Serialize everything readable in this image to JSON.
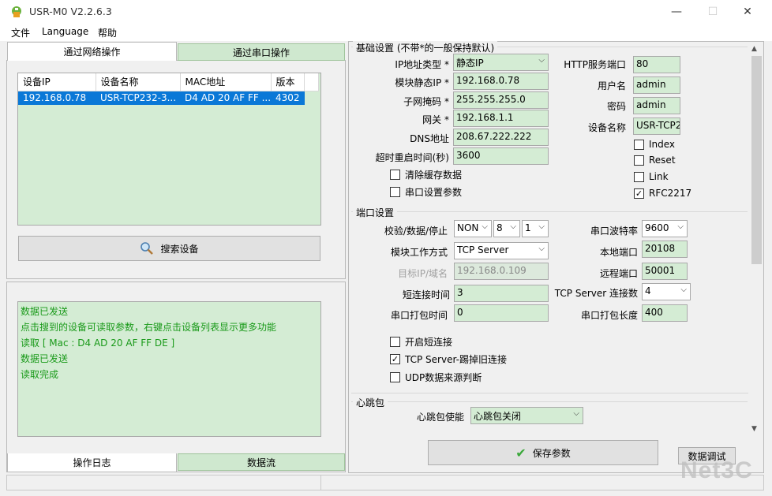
{
  "window": {
    "title": "USR-M0 V2.2.6.3"
  },
  "controls": {
    "minimize": "—",
    "maximize": "☐",
    "close": "✕"
  },
  "menu": [
    "文件",
    "Language",
    "帮助"
  ],
  "left": {
    "tabs": [
      "通过网络操作",
      "通过串口操作"
    ],
    "table": {
      "columns": [
        "设备IP",
        "设备名称",
        "MAC地址",
        "版本"
      ],
      "rows": [
        [
          "192.168.0.78",
          "USR-TCP232-3...",
          "D4 AD 20 AF FF ...",
          "4302"
        ]
      ]
    },
    "search_button": "搜索设备",
    "log": [
      "数据已发送",
      "点击搜到的设备可读取参数，右键点击设备列表显示更多功能",
      "读取 [ Mac : D4 AD 20 AF FF DE ]",
      "数据已发送",
      "读取完成"
    ],
    "bottom_tabs": [
      "操作日志",
      "数据流"
    ]
  },
  "basic": {
    "title": "基础设置 (不带*的一般保持默认)",
    "ip_type_label": "IP地址类型 *",
    "ip_type_value": "静态IP",
    "static_ip_label": "模块静态IP *",
    "static_ip_value": "192.168.0.78",
    "mask_label": "子网掩码 *",
    "mask_value": "255.255.255.0",
    "gateway_label": "网关 *",
    "gateway_value": "192.168.1.1",
    "dns_label": "DNS地址",
    "dns_value": "208.67.222.222",
    "timeout_label": "超时重启时间(秒)",
    "timeout_value": "3600",
    "clear_cache": "清除缓存数据",
    "serial_params": "串口设置参数",
    "http_port_label": "HTTP服务端口",
    "http_port_value": "80",
    "user_label": "用户名",
    "user_value": "admin",
    "pass_label": "密码",
    "pass_value": "admin",
    "devname_label": "设备名称",
    "devname_value": "USR-TCP2",
    "index": "Index",
    "reset": "Reset",
    "link": "Link",
    "rfc": "RFC2217"
  },
  "serial": {
    "title": "端口设置",
    "parity_label": "校验/数据/停止",
    "parity_value": "NON",
    "data_bits": "8",
    "stop_bits": "1",
    "mode_label": "模块工作方式",
    "mode_value": "TCP Server",
    "target_label": "目标IP/域名",
    "target_value": "192.168.0.109",
    "short_time_label": "短连接时间",
    "short_time_value": "3",
    "pack_time_label": "串口打包时间",
    "pack_time_value": "0",
    "baud_label": "串口波特率",
    "baud_value": "9600",
    "local_port_label": "本地端口",
    "local_port_value": "20108",
    "remote_port_label": "远程端口",
    "remote_port_value": "50001",
    "conn_count_label": "TCP Server 连接数",
    "conn_count_value": "4",
    "pack_len_label": "串口打包长度",
    "pack_len_value": "400",
    "short_conn": "开启短连接",
    "kick_old": "TCP Server-踢掉旧连接",
    "udp_judge": "UDP数据来源判断"
  },
  "heartbeat": {
    "title": "心跳包",
    "enable_label": "心跳包使能",
    "enable_value": "心跳包关闭"
  },
  "actions": {
    "save": "保存参数",
    "debug": "数据调试"
  },
  "watermark": "Net3C"
}
